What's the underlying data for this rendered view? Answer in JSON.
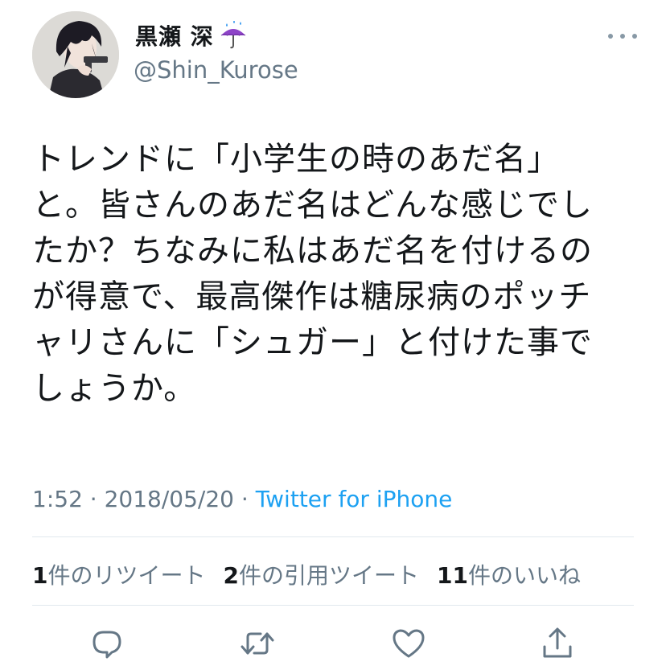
{
  "user": {
    "display_name": "黒瀬 深",
    "handle": "@Shin_Kurose"
  },
  "tweet": {
    "lines": [
      "トレンドに「小学生の時のあだ名」",
      "と。皆さんのあだ名はどんな感じでし",
      "たか？ちなみに私はあだ名を付けるの",
      "が得意で、最高傑作は糖尿病のポッチ",
      "ャリさんに「シュガー」と付けた事で",
      "しょうか。"
    ]
  },
  "meta": {
    "time": "1:52",
    "separator1": " · ",
    "date": "2018/05/20",
    "separator2": " · ",
    "source": "Twitter for iPhone"
  },
  "stats": {
    "retweets_count": "1",
    "retweets_label": "件のリツイート",
    "quotes_count": "2",
    "quotes_label": "件の引用ツイート",
    "likes_count": "11",
    "likes_label": "件のいいね"
  },
  "colors": {
    "accent": "#1da1f2",
    "secondary_text": "#657786",
    "icon": "#657786"
  },
  "icons": [
    "umbrella-rain-icon",
    "more-icon",
    "reply-icon",
    "retweet-icon",
    "like-icon",
    "share-icon"
  ]
}
